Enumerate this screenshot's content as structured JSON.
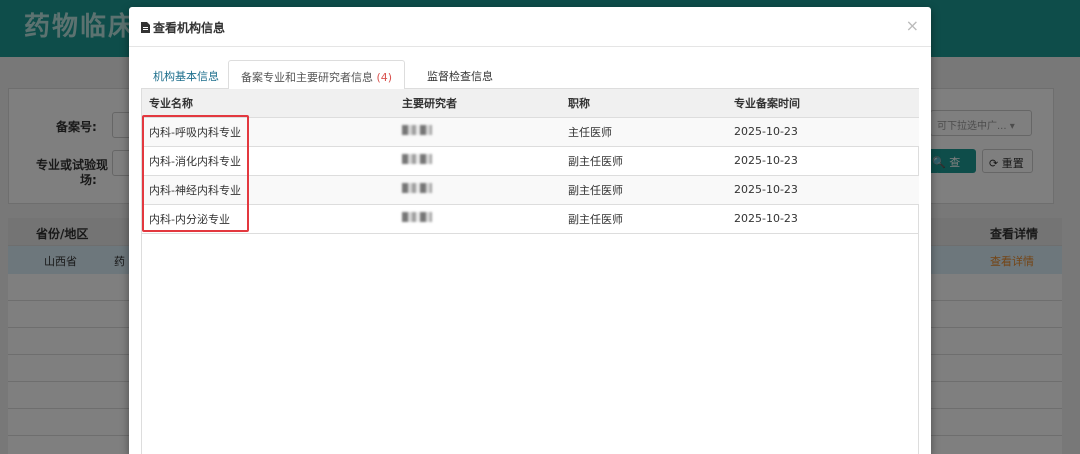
{
  "background": {
    "app_title": "药物临床",
    "labels": {
      "filing_no": "备案号:",
      "specialty_1": "专业或试验现",
      "specialty_2": "场:"
    },
    "select_placeholder": "可下拉选中广...",
    "search_button": "查询",
    "reset_button": "重置",
    "columns": {
      "province": "省份/地区",
      "detail": "查看详情"
    },
    "row": {
      "province": "山西省",
      "institution_partial": "药",
      "detail_link": "查看详情"
    }
  },
  "modal": {
    "title": "查看机构信息",
    "close": "×",
    "tabs": [
      {
        "label": "机构基本信息",
        "active": false
      },
      {
        "label": "备案专业和主要研究者信息",
        "count": "(4)",
        "active": true
      },
      {
        "label": "监督检查信息",
        "active": false
      }
    ],
    "table": {
      "headers": [
        "专业名称",
        "主要研究者",
        "职称",
        "专业备案时间"
      ],
      "rows": [
        {
          "specialty": "内科-呼吸内科专业",
          "title": "主任医师",
          "date": "2025-10-23"
        },
        {
          "specialty": "内科-消化内科专业",
          "title": "副主任医师",
          "date": "2025-10-23"
        },
        {
          "specialty": "内科-神经内科专业",
          "title": "副主任医师",
          "date": "2025-10-23"
        },
        {
          "specialty": "内科-内分泌专业",
          "title": "副主任医师",
          "date": "2025-10-23"
        }
      ]
    }
  },
  "colors": {
    "brand_teal": "#1c9b94",
    "highlight_red": "#e3383f",
    "link_orange": "#e88a2b"
  }
}
